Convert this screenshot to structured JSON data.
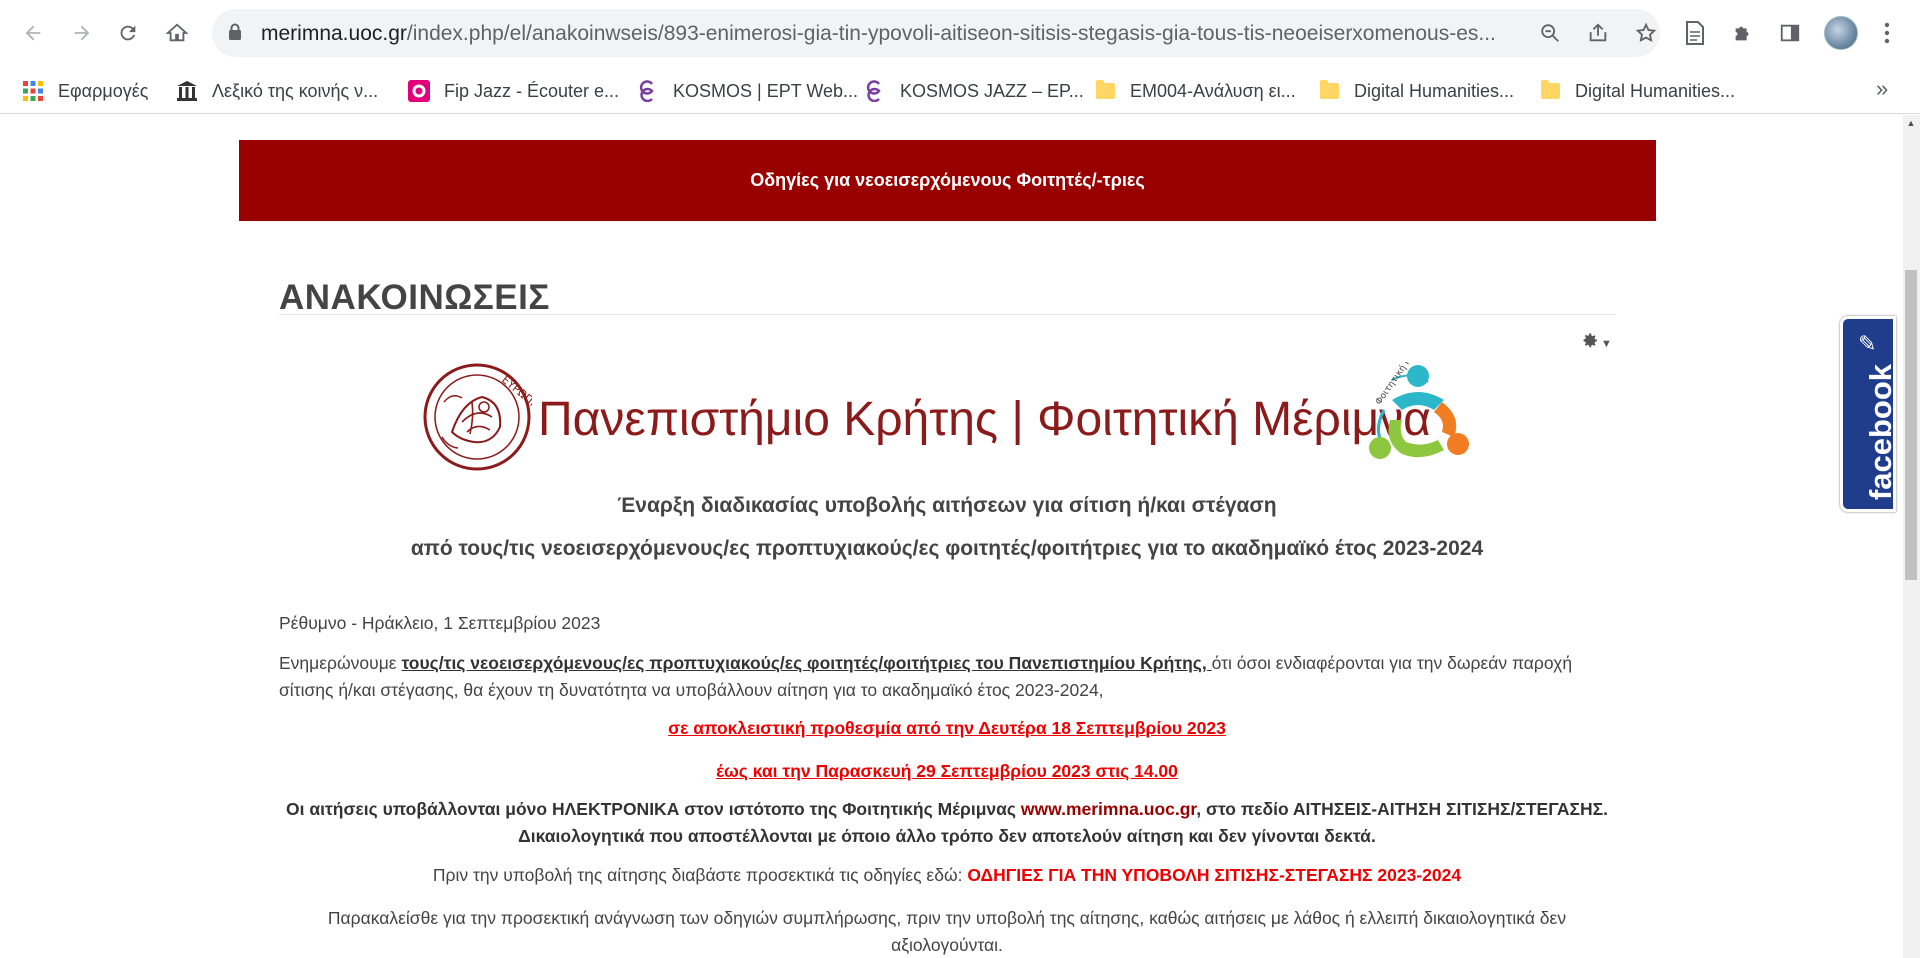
{
  "browser": {
    "url_host": "merimna.uoc.gr",
    "url_path": "/index.php/el/anakoinwseis/893-enimerosi-gia-tin-ypovoli-aitiseon-sitisis-stegasis-gia-tous-tis-neoeiserxomenous-es..."
  },
  "bookmarks": {
    "apps": "Εφαρμογές",
    "items": [
      {
        "label": "Λεξικό της κοινής ν..."
      },
      {
        "label": "Fip Jazz - Écouter e..."
      },
      {
        "label": "KOSMOS | ΕΡΤ Web..."
      },
      {
        "label": "KOSMOS JAZZ – ΕΡ..."
      },
      {
        "label": "ΕΜ004-Ανάλυση ει..."
      },
      {
        "label": "Digital Humanities..."
      },
      {
        "label": "Digital Humanities..."
      }
    ],
    "more": "»"
  },
  "page": {
    "banner": "Οδηγίες για νεοεισερχόμενους Φοιτητές/-τριες",
    "title": "ΑΝΑΚΟΙΝΩΣΕΙΣ",
    "logo_text": "Πανεπιστήμιο Κρήτης | Φοιτητική Μέριμνα",
    "seal_text": "ΕΥΡΩΠΗ",
    "merimna_text": "Φοιτητική Μέριμνα",
    "subhead_1": "Έναρξη διαδικασίας υποβολής αιτήσεων για σίτιση ή/και στέγαση",
    "subhead_2": "από τους/τις νεοεισερχόμενους/ες προπτυχιακούς/ες φοιτητές/φοιτήτριες για το ακαδημαϊκό έτος 2023-2024",
    "place_date_a": "Ρέθυμνο",
    "place_date_b": " - ",
    "place_date_c": "Ηράκλειο, 1 Σεπτεμβρίου 2023",
    "p1_a": "Ενημερώνουμε ",
    "p1_b": "τους/τις νεοεισερχόμενους/ες προπτυχιακούς/ες φοιτητές/φοιτήτριες του Πανεπιστημίου Κρήτης, ",
    "p1_c": "ότι όσοι ενδιαφέρονται για την δωρεάν παροχή σίτισης ή/και στέγασης, θα έχουν τη δυνατότητα να υποβάλλουν αίτηση για το ακαδημαϊκό έτος 2023-2024,",
    "deadline_1": "σε αποκλειστική προθεσμία από την Δευτέρα 18 Σεπτεμβρίου 2023",
    "deadline_2": "έως και την Παρασκευή 29 Σεπτεμβρίου 2023 στις 14.00",
    "p2_a": "Οι αιτήσεις υποβάλλονται μόνο ΗΛΕΚΤΡΟΝΙΚΑ στον ιστότοπο της Φοιτητικής Μέριμνας ",
    "p2_link": "www.merimna.uoc.gr",
    "p2_b": ", στο πεδίο ΑΙΤΗΣΕΙΣ-ΑΙΤΗΣΗ ΣΙΤΙΣΗΣ/ΣΤΕΓΑΣΗΣ.",
    "p2_c": "Δικαιολογητικά που αποστέλλονται με όποιο άλλο τρόπο δεν αποτελούν αίτηση και δεν γίνονται δεκτά.",
    "p3_a": "Πριν την υποβολή της αίτησης διαβάστε προσεκτικά τις οδηγίες εδώ: ",
    "p3_link": "ΟΔΗΓΙΕΣ ΓΙΑ ΤΗΝ ΥΠΟΒΟΛΗ ΣΙΤΙΣΗΣ-ΣΤΕΓΑΣΗΣ 2023-2024",
    "p4": "Παρακαλείσθε για την προσεκτική ανάγνωση των οδηγιών συμπλήρωσης, πριν την υποβολή της αίτησης, καθώς αιτήσεις με λάθος ή ελλειπή δικαιολογητικά δεν αξιολογούνται."
  },
  "facebook_tab": "facebook",
  "colors": {
    "banner": "#990000",
    "logo_red": "#8b1a1a",
    "highlight_red": "#ee0000",
    "facebook_blue": "#1f3d8a"
  }
}
